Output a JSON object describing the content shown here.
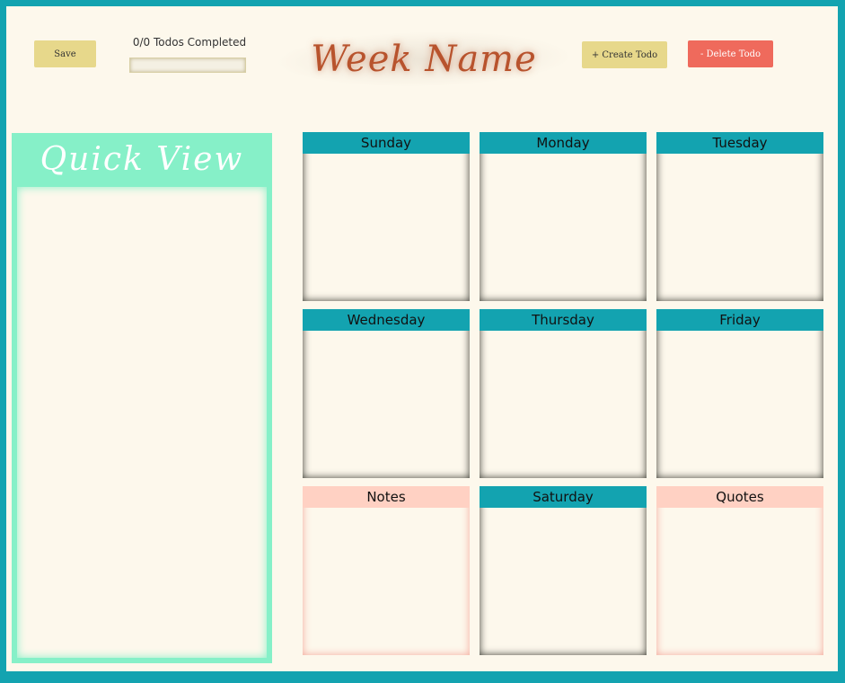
{
  "toolbar": {
    "save_label": "Save",
    "create_label": "+ Create Todo",
    "delete_label": "- Delete Todo"
  },
  "progress": {
    "text": "0/0 Todos Completed",
    "completed": 0,
    "total": 0
  },
  "header": {
    "title": "Week Name"
  },
  "quick_view": {
    "title": "Quick View"
  },
  "days": {
    "sunday": "Sunday",
    "monday": "Monday",
    "tuesday": "Tuesday",
    "wednesday": "Wednesday",
    "thursday": "Thursday",
    "friday": "Friday",
    "saturday": "Saturday"
  },
  "notes": {
    "title": "Notes"
  },
  "quotes": {
    "title": "Quotes"
  },
  "colors": {
    "frame": "#13a3b0",
    "background": "#fdf8ec",
    "button_yellow": "#e7d88b",
    "button_red": "#ef6a5c",
    "quick_view_green": "#86f0c8",
    "note_pink": "#ffd1c3",
    "title_brown": "#b8532d"
  }
}
